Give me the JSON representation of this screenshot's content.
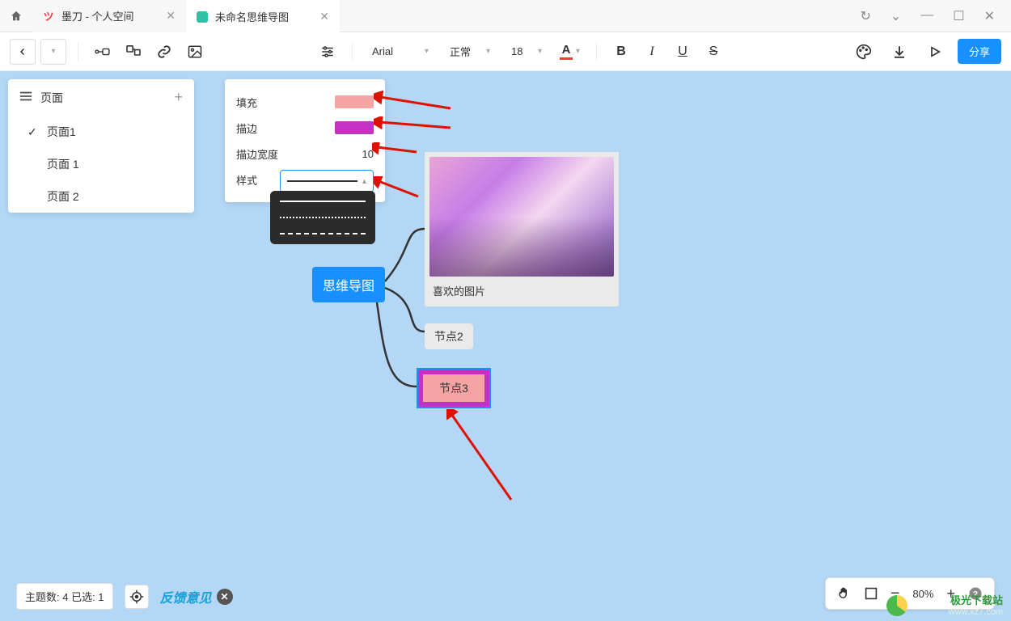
{
  "tabs": {
    "home_aria": "home",
    "tab1": {
      "title": "墨刀 - 个人空间",
      "favcolor": "#ff3344"
    },
    "tab2": {
      "title": "未命名思维导图",
      "favcolor": "#2bc3a6"
    }
  },
  "win": {
    "reload": "↻",
    "down": "⌄",
    "min": "—",
    "max": "☐",
    "close": "✕"
  },
  "toolbar": {
    "font": "Arial",
    "style": "正常",
    "size": "18",
    "share": "分享"
  },
  "pages": {
    "title": "页面",
    "items": [
      {
        "label": "页面1",
        "checked": true
      },
      {
        "label": "页面 1",
        "checked": false
      },
      {
        "label": "页面 2",
        "checked": false
      }
    ]
  },
  "style_panel": {
    "fill_label": "填充",
    "fill_color": "#f5a3a3",
    "stroke_label": "描边",
    "stroke_color": "#c332c3",
    "width_label": "描边宽度",
    "width_value": "10",
    "line_label": "样式"
  },
  "nodes": {
    "root": "思维导图",
    "img_caption": "喜欢的图片",
    "n2": "节点2",
    "n3": "节点3"
  },
  "status": {
    "count_label": "主题数: 4 已选: 1",
    "feedback": "反馈意见"
  },
  "zoom": {
    "percent": "80%"
  },
  "watermark": {
    "brand": "极光下载站",
    "url": "www.xz7.com"
  }
}
